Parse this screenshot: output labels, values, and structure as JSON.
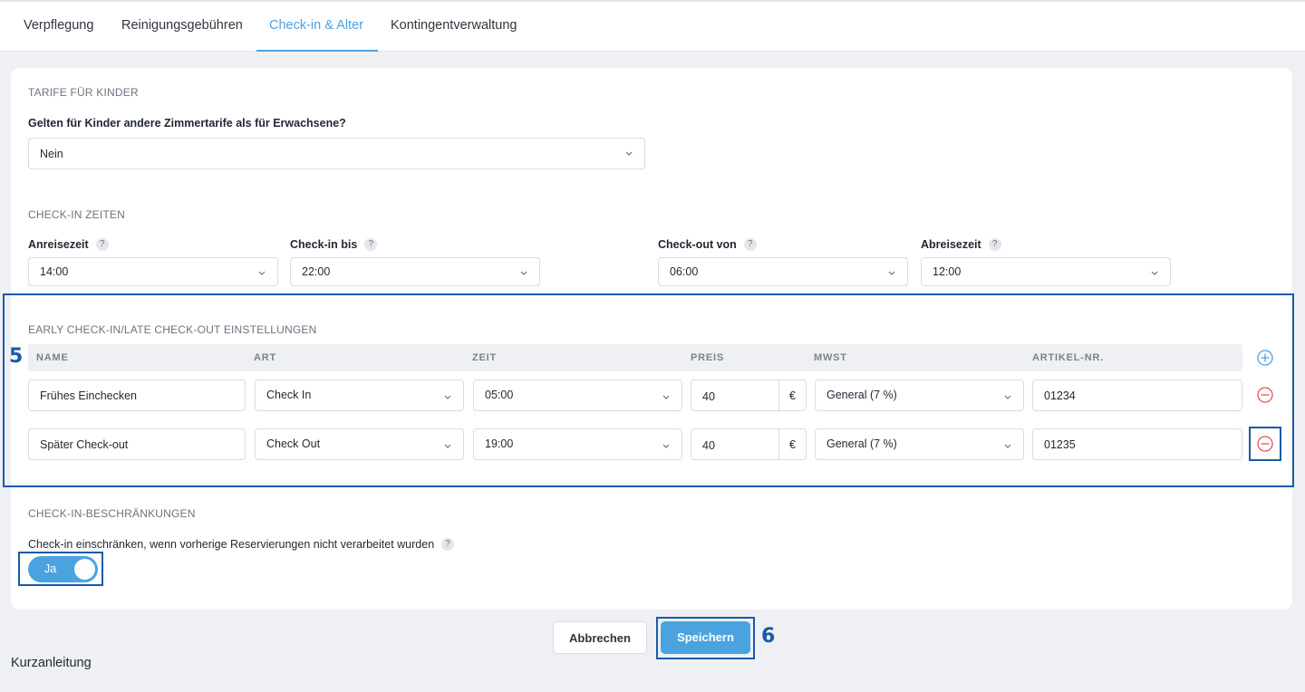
{
  "tabs": [
    {
      "label": "Verpflegung",
      "active": false
    },
    {
      "label": "Reinigungsgebühren",
      "active": false
    },
    {
      "label": "Check-in & Alter",
      "active": true
    },
    {
      "label": "Kontingentverwaltung",
      "active": false
    }
  ],
  "children_rates": {
    "section_title": "TARIFE FÜR KINDER",
    "question": "Gelten für Kinder andere Zimmertarife als für Erwachsene?",
    "selected": "Nein"
  },
  "checkin_times": {
    "section_title": "CHECK-IN ZEITEN",
    "fields": [
      {
        "label": "Anreisezeit",
        "value": "14:00"
      },
      {
        "label": "Check-in bis",
        "value": "22:00"
      },
      {
        "label": "Check-out von",
        "value": "06:00"
      },
      {
        "label": "Abreisezeit",
        "value": "12:00"
      }
    ],
    "help_glyph": "?"
  },
  "early_late": {
    "section_title": "EARLY CHECK-IN/LATE CHECK-OUT EINSTELLUNGEN",
    "columns": [
      "NAME",
      "ART",
      "ZEIT",
      "PREIS",
      "MWST",
      "ARTIKEL-NR."
    ],
    "rows": [
      {
        "name": "Frühes Einchecken",
        "type": "Check In",
        "time": "05:00",
        "price": "40",
        "currency": "€",
        "vat": "General (7 %)",
        "article": "01234"
      },
      {
        "name": "Später Check-out",
        "type": "Check Out",
        "time": "19:00",
        "price": "40",
        "currency": "€",
        "vat": "General (7 %)",
        "article": "01235"
      }
    ]
  },
  "restrictions": {
    "section_title": "CHECK-IN-BESCHRÄNKUNGEN",
    "question": "Check-in einschränken, wenn vorherige Reservierungen nicht verarbeitet wurden",
    "toggle_label": "Ja",
    "toggle_on": true
  },
  "actions": {
    "cancel": "Abbrechen",
    "save": "Speichern"
  },
  "annotations": {
    "step5": "5",
    "step6": "6"
  },
  "guide": {
    "title": "Kurzanleitung"
  },
  "colors": {
    "accent": "#4aa3df",
    "annotation": "#1a5aa6",
    "remove": "#e25555"
  }
}
